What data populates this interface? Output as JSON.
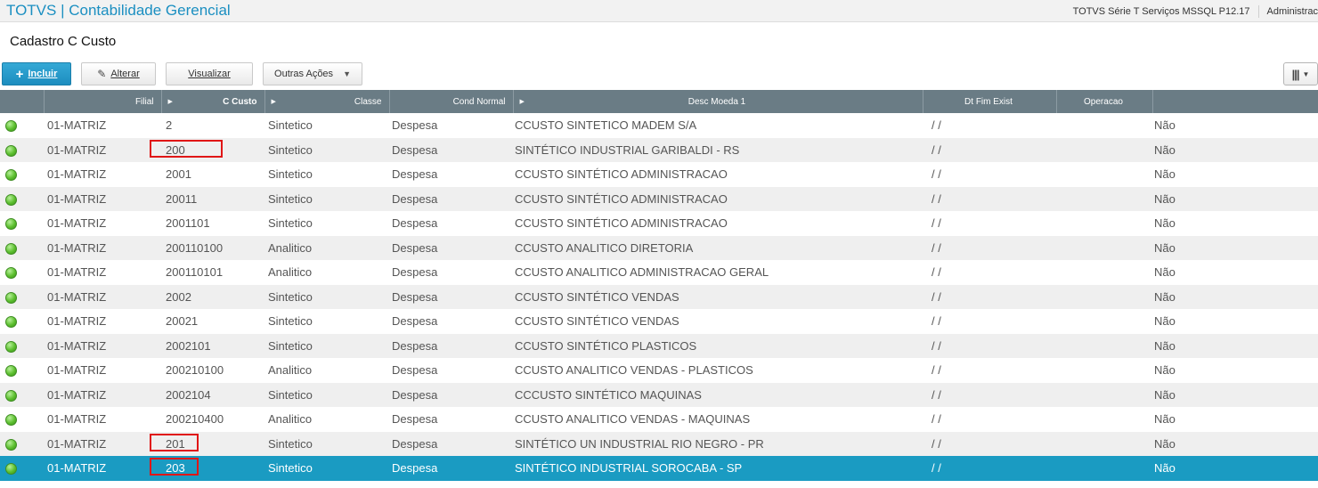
{
  "header": {
    "app_title": "TOTVS | Contabilidade Gerencial",
    "environment": "TOTVS Série T Serviços MSSQL P12.17",
    "user": "Administrac"
  },
  "page_title": "Cadastro C Custo",
  "toolbar": {
    "include_label": "Incluir",
    "edit_label": "Alterar",
    "view_label": "Visualizar",
    "more_label": "Outras Ações"
  },
  "icons": {
    "plus": "plus-icon",
    "edit": "pencil-icon",
    "dropdown": "chevron-down-icon",
    "columns": "columns-icon",
    "status": "green-status-icon"
  },
  "colors": {
    "accent": "#1b8fc1",
    "header_bg": "#6a7c85",
    "selected_row": "#1a9bc2",
    "highlight_box": "#e01616",
    "status_green": "#5cbf2e"
  },
  "grid": {
    "columns": [
      "",
      "Filial",
      "C Custo",
      "Classe",
      "Cond Normal",
      "Desc Moeda 1",
      "Dt Fim Exist",
      "Operacao",
      ""
    ],
    "rows": [
      {
        "filial": "01-MATRIZ",
        "ccusto": "2",
        "classe": "Sintetico",
        "cond": "Despesa",
        "desc": "CCUSTO SINTETICO MADEM S/A",
        "dtfim": "/ /",
        "oper": "",
        "last": "Não"
      },
      {
        "filial": "01-MATRIZ",
        "ccusto": "200",
        "classe": "Sintetico",
        "cond": "Despesa",
        "desc": "SINTÉTICO INDUSTRIAL GARIBALDI - RS",
        "dtfim": "/ /",
        "oper": "",
        "last": "Não"
      },
      {
        "filial": "01-MATRIZ",
        "ccusto": "2001",
        "classe": "Sintetico",
        "cond": "Despesa",
        "desc": "CCUSTO SINTÉTICO ADMINISTRACAO",
        "dtfim": "/ /",
        "oper": "",
        "last": "Não"
      },
      {
        "filial": "01-MATRIZ",
        "ccusto": "20011",
        "classe": "Sintetico",
        "cond": "Despesa",
        "desc": "CCUSTO SINTÉTICO ADMINISTRACAO",
        "dtfim": "/ /",
        "oper": "",
        "last": "Não"
      },
      {
        "filial": "01-MATRIZ",
        "ccusto": "2001101",
        "classe": "Sintetico",
        "cond": "Despesa",
        "desc": "CCUSTO SINTÉTICO ADMINISTRACAO",
        "dtfim": "/ /",
        "oper": "",
        "last": "Não"
      },
      {
        "filial": "01-MATRIZ",
        "ccusto": "200110100",
        "classe": "Analitico",
        "cond": "Despesa",
        "desc": "CCUSTO ANALITICO DIRETORIA",
        "dtfim": "/ /",
        "oper": "",
        "last": "Não"
      },
      {
        "filial": "01-MATRIZ",
        "ccusto": "200110101",
        "classe": "Analitico",
        "cond": "Despesa",
        "desc": "CCUSTO ANALITICO  ADMINISTRACAO GERAL",
        "dtfim": "/ /",
        "oper": "",
        "last": "Não"
      },
      {
        "filial": "01-MATRIZ",
        "ccusto": "2002",
        "classe": "Sintetico",
        "cond": "Despesa",
        "desc": "CCUSTO SINTÉTICO VENDAS",
        "dtfim": "/ /",
        "oper": "",
        "last": "Não"
      },
      {
        "filial": "01-MATRIZ",
        "ccusto": "20021",
        "classe": "Sintetico",
        "cond": "Despesa",
        "desc": "CCUSTO SINTÉTICO VENDAS",
        "dtfim": "/ /",
        "oper": "",
        "last": "Não"
      },
      {
        "filial": "01-MATRIZ",
        "ccusto": "2002101",
        "classe": "Sintetico",
        "cond": "Despesa",
        "desc": "CCUSTO SINTÉTICO PLASTICOS",
        "dtfim": "/ /",
        "oper": "",
        "last": "Não"
      },
      {
        "filial": "01-MATRIZ",
        "ccusto": "200210100",
        "classe": "Analitico",
        "cond": "Despesa",
        "desc": "CCUSTO ANALITICO VENDAS - PLASTICOS",
        "dtfim": "/ /",
        "oper": "",
        "last": "Não"
      },
      {
        "filial": "01-MATRIZ",
        "ccusto": "2002104",
        "classe": "Sintetico",
        "cond": "Despesa",
        "desc": "CCCUSTO SINTÉTICO MAQUINAS",
        "dtfim": "/ /",
        "oper": "",
        "last": "Não"
      },
      {
        "filial": "01-MATRIZ",
        "ccusto": "200210400",
        "classe": "Analitico",
        "cond": "Despesa",
        "desc": "CCUSTO ANALITICO VENDAS - MAQUINAS",
        "dtfim": "/ /",
        "oper": "",
        "last": "Não"
      },
      {
        "filial": "01-MATRIZ",
        "ccusto": "201",
        "classe": "Sintetico",
        "cond": "Despesa",
        "desc": "SINTÉTICO UN INDUSTRIAL RIO NEGRO - PR",
        "dtfim": "/ /",
        "oper": "",
        "last": "Não"
      },
      {
        "filial": "01-MATRIZ",
        "ccusto": "203",
        "classe": "Sintetico",
        "cond": "Despesa",
        "desc": "SINTÉTICO INDUSTRIAL SOROCABA - SP",
        "dtfim": "/ /",
        "oper": "",
        "last": "Não"
      }
    ],
    "selected_row_index": 14,
    "highlighted_ccusto_rows": [
      1,
      13,
      14
    ]
  }
}
